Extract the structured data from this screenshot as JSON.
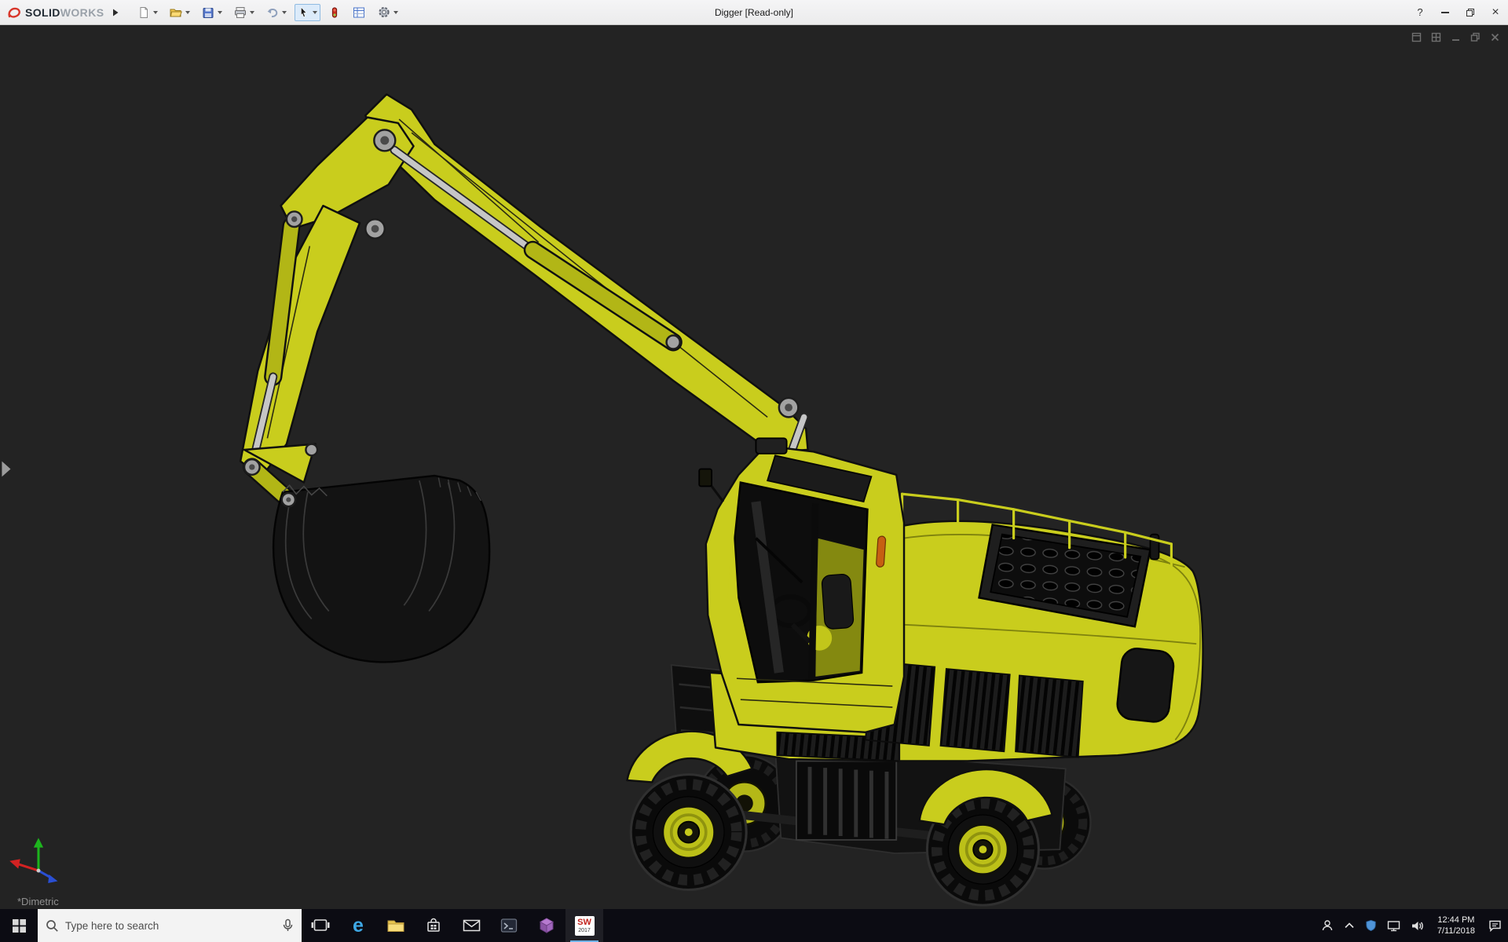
{
  "title_bar": {
    "brand_solid": "SOLID",
    "brand_works": "WORKS",
    "document_title": "Digger [Read-only]",
    "help_label": "?",
    "close_label": "×"
  },
  "toolbar": {
    "icons": [
      "new-document",
      "open",
      "save",
      "print",
      "undo",
      "select-arrow",
      "rebuild",
      "file-properties",
      "options"
    ]
  },
  "viewport": {
    "orientation_label": "*Dimetric",
    "background_color": "#232323",
    "model_body_color": "#c9cd1d",
    "child_window_controls": [
      "new-window",
      "tile-windows",
      "minimize-document",
      "restore-document",
      "close-document"
    ]
  },
  "taskbar": {
    "search_placeholder": "Type here to search",
    "clock_time": "12:44 PM",
    "clock_date": "7/11/2018",
    "edge_glyph": "e",
    "solidworks_badge": {
      "label": "SW",
      "year": "2017"
    },
    "apps": [
      "start",
      "search",
      "task-view",
      "edge",
      "file-explorer",
      "store",
      "mail",
      "console",
      "3d-app",
      "solidworks-2017"
    ],
    "tray_icons": [
      "people",
      "chevron-up",
      "shield",
      "network",
      "volume",
      "clock",
      "action-center"
    ]
  }
}
